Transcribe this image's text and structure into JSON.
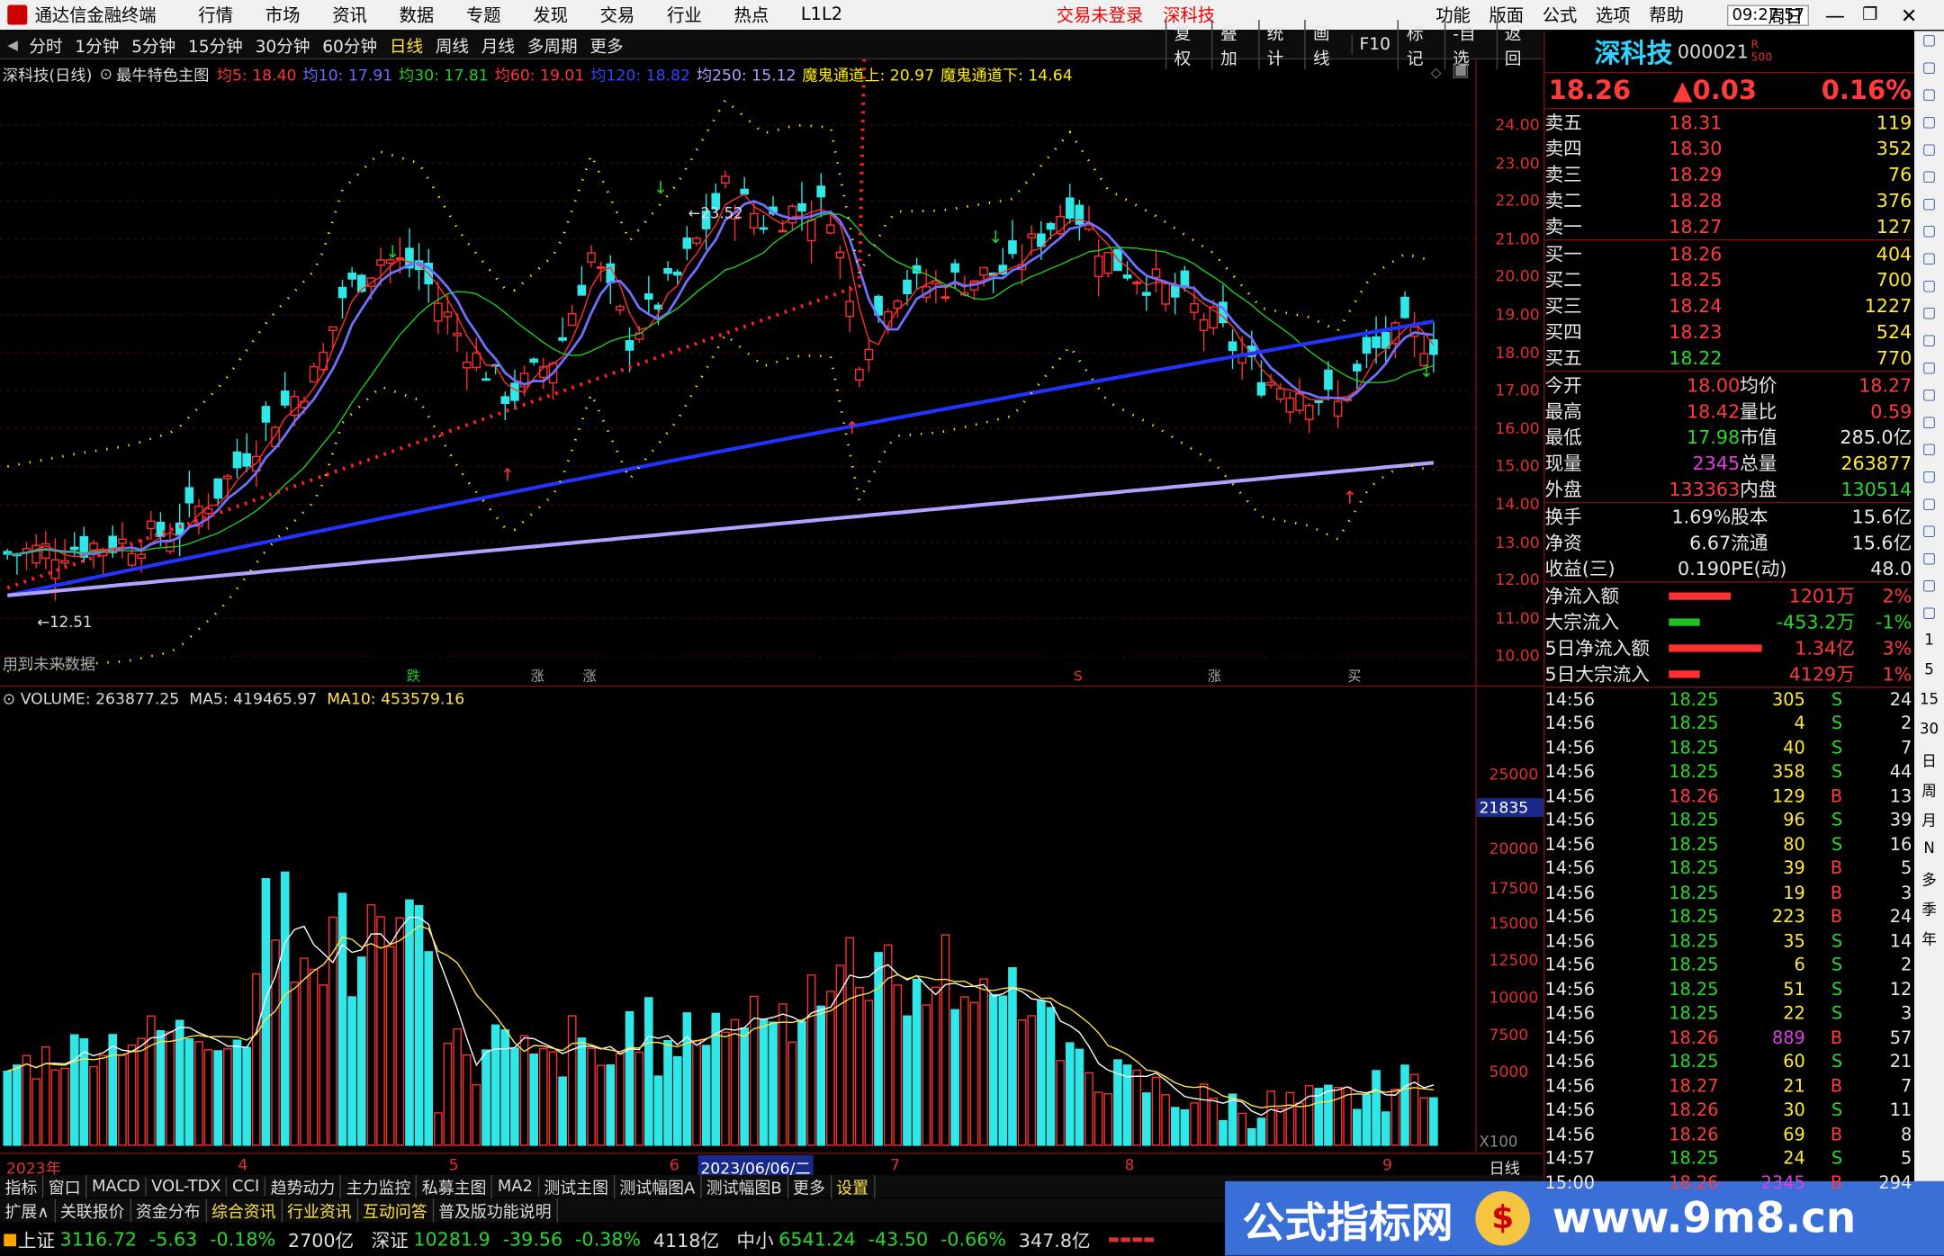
{
  "titlebar": {
    "app_name": "通达信金融终端",
    "menu": [
      "行情",
      "市场",
      "资讯",
      "数据",
      "专题",
      "发现",
      "交易",
      "行业",
      "热点",
      "L1L2"
    ],
    "status": "交易未登录",
    "stock": "深科技",
    "right_menu": [
      "功能",
      "版面",
      "公式",
      "选项",
      "帮助"
    ],
    "time": "09:27:57",
    "weekday": "周日"
  },
  "period_bar": {
    "periods": [
      "分时",
      "1分钟",
      "5分钟",
      "15分钟",
      "30分钟",
      "60分钟",
      "日线",
      "周线",
      "月线",
      "多周期",
      "更多"
    ],
    "active": "日线",
    "tools": [
      "复权",
      "叠加",
      "统计",
      "画线",
      "F10",
      "标记",
      "-自选",
      "返回"
    ]
  },
  "main_chart": {
    "stock_label": "深科技(日线)",
    "indicator_name": "最牛特色主图",
    "ma": [
      {
        "label": "均5: 18.40",
        "color": "#ff3333"
      },
      {
        "label": "均10: 17.91",
        "color": "#6a6aff"
      },
      {
        "label": "均30: 17.81",
        "color": "#22cc22"
      },
      {
        "label": "均60: 19.01",
        "color": "#ff3333"
      },
      {
        "label": "均120: 18.82",
        "color": "#3344ff"
      },
      {
        "label": "均250: 15.12",
        "color": "#b0a0ff"
      },
      {
        "label": "魔鬼通道上: 20.97",
        "color": "#ffee00"
      },
      {
        "label": "魔鬼通道下: 14.64",
        "color": "#ffee00"
      }
    ],
    "high_marker": "23.52",
    "low_marker": "12.51",
    "future_note": "用到未来数据",
    "price_axis": [
      "24.00",
      "23.00",
      "22.00",
      "21.00",
      "20.00",
      "19.00",
      "18.00",
      "17.00",
      "16.00",
      "15.00",
      "14.00",
      "13.00",
      "12.00",
      "11.00",
      "10.00"
    ],
    "signal_labels": [
      "跌",
      "涨",
      "涨",
      "S",
      "涨",
      "买"
    ]
  },
  "volume_chart": {
    "label": "VOLUME: 263877.25",
    "ma5": "MA5: 419465.97",
    "ma10": "MA10: 453579.16",
    "axis": [
      "25000",
      "20000",
      "17500",
      "15000",
      "12500",
      "10000",
      "7500",
      "5000"
    ],
    "cursor_value": "21835",
    "unit": "X100"
  },
  "date_axis": {
    "labels": [
      "2023年",
      "4",
      "5",
      "6",
      "7",
      "8",
      "9"
    ],
    "cursor_date": "2023/06/06/二",
    "period": "日线"
  },
  "bottom_tabs": [
    "指标",
    "窗口",
    "MACD",
    "VOL-TDX",
    "CCI",
    "趋势动力",
    "主力监控",
    "私募主图",
    "MA2",
    "测试主图",
    "测试幅图A",
    "测试幅图B",
    "更多",
    "设置"
  ],
  "bottom_tabs2": [
    "扩展∧",
    "关联报价",
    "资金分布",
    "综合资讯",
    "行业资讯",
    "互动问答",
    "普及版功能说明"
  ],
  "index_bar": [
    {
      "name": "上证",
      "value": "3116.72",
      "chg": "-5.63",
      "pct": "-0.18%",
      "amt": "2700亿"
    },
    {
      "name": "深证",
      "value": "10281.9",
      "chg": "-39.56",
      "pct": "-0.38%",
      "amt": "4118亿"
    },
    {
      "name": "中小",
      "value": "6541.24",
      "chg": "-43.50",
      "pct": "-0.66%",
      "amt": "347.8亿"
    }
  ],
  "watermark": {
    "text1": "公式指标网",
    "text2": "www.9m8.cn"
  },
  "quote": {
    "name": "深科技",
    "code": "000021",
    "badge1": "R",
    "badge2": "500",
    "price": "18.26",
    "change": "▲0.03",
    "pct": "0.16%",
    "asks": [
      {
        "label": "卖五",
        "price": "18.31",
        "vol": "119"
      },
      {
        "label": "卖四",
        "price": "18.30",
        "vol": "352"
      },
      {
        "label": "卖三",
        "price": "18.29",
        "vol": "76"
      },
      {
        "label": "卖二",
        "price": "18.28",
        "vol": "376"
      },
      {
        "label": "卖一",
        "price": "18.27",
        "vol": "127"
      }
    ],
    "bids": [
      {
        "label": "买一",
        "price": "18.26",
        "vol": "404"
      },
      {
        "label": "买二",
        "price": "18.25",
        "vol": "700"
      },
      {
        "label": "买三",
        "price": "18.24",
        "vol": "1227"
      },
      {
        "label": "买四",
        "price": "18.23",
        "vol": "524"
      },
      {
        "label": "买五",
        "price": "18.22",
        "vol": "770"
      }
    ],
    "stats": [
      {
        "k1": "今开",
        "v1": "18.00",
        "k2": "均价",
        "v2": "18.27"
      },
      {
        "k1": "最高",
        "v1": "18.42",
        "k2": "量比",
        "v2": "0.59"
      },
      {
        "k1": "最低",
        "v1": "17.98",
        "k2": "市值",
        "v2": "285.0亿"
      },
      {
        "k1": "现量",
        "v1": "2345",
        "k2": "总量",
        "v2": "263877"
      },
      {
        "k1": "外盘",
        "v1": "133363",
        "k2": "内盘",
        "v2": "130514"
      }
    ],
    "stats2": [
      {
        "k1": "换手",
        "v1": "1.69%",
        "k2": "股本",
        "v2": "15.6亿"
      },
      {
        "k1": "净资",
        "v1": "6.67",
        "k2": "流通",
        "v2": "15.6亿"
      },
      {
        "k1": "收益(三)",
        "v1": "0.190",
        "k2": "PE(动)",
        "v2": "48.0"
      }
    ],
    "flows": [
      {
        "label": "净流入额",
        "value": "1201万",
        "pct": "2%",
        "bar": 0.02
      },
      {
        "label": "大宗流入",
        "value": "-453.2万",
        "pct": "-1%",
        "bar": -0.01
      },
      {
        "label": "5日净流入额",
        "value": "1.34亿",
        "pct": "3%",
        "bar": 0.03
      },
      {
        "label": "5日大宗流入",
        "value": "4129万",
        "pct": "1%",
        "bar": 0.01
      }
    ],
    "ticks": [
      {
        "t": "14:56",
        "p": "18.25",
        "v": "305",
        "s": "S",
        "n": "24"
      },
      {
        "t": "14:56",
        "p": "18.25",
        "v": "4",
        "s": "S",
        "n": "2"
      },
      {
        "t": "14:56",
        "p": "18.25",
        "v": "40",
        "s": "S",
        "n": "7"
      },
      {
        "t": "14:56",
        "p": "18.25",
        "v": "358",
        "s": "S",
        "n": "44"
      },
      {
        "t": "14:56",
        "p": "18.26",
        "v": "129",
        "s": "B",
        "n": "13"
      },
      {
        "t": "14:56",
        "p": "18.25",
        "v": "96",
        "s": "S",
        "n": "39"
      },
      {
        "t": "14:56",
        "p": "18.25",
        "v": "80",
        "s": "S",
        "n": "16"
      },
      {
        "t": "14:56",
        "p": "18.25",
        "v": "39",
        "s": "B",
        "n": "5"
      },
      {
        "t": "14:56",
        "p": "18.25",
        "v": "19",
        "s": "B",
        "n": "3"
      },
      {
        "t": "14:56",
        "p": "18.25",
        "v": "223",
        "s": "B",
        "n": "24"
      },
      {
        "t": "14:56",
        "p": "18.25",
        "v": "35",
        "s": "S",
        "n": "14"
      },
      {
        "t": "14:56",
        "p": "18.25",
        "v": "6",
        "s": "S",
        "n": "2"
      },
      {
        "t": "14:56",
        "p": "18.25",
        "v": "51",
        "s": "S",
        "n": "12"
      },
      {
        "t": "14:56",
        "p": "18.25",
        "v": "22",
        "s": "S",
        "n": "3"
      },
      {
        "t": "14:56",
        "p": "18.26",
        "v": "889",
        "s": "B",
        "n": "57"
      },
      {
        "t": "14:56",
        "p": "18.25",
        "v": "60",
        "s": "S",
        "n": "21"
      },
      {
        "t": "14:56",
        "p": "18.27",
        "v": "21",
        "s": "B",
        "n": "7"
      },
      {
        "t": "14:56",
        "p": "18.26",
        "v": "30",
        "s": "S",
        "n": "11"
      },
      {
        "t": "14:56",
        "p": "18.26",
        "v": "69",
        "s": "B",
        "n": "8"
      },
      {
        "t": "14:57",
        "p": "18.25",
        "v": "24",
        "s": "S",
        "n": "5"
      },
      {
        "t": "15:00",
        "p": "18.26",
        "v": "2345",
        "s": "B",
        "n": "294"
      }
    ]
  },
  "side_toolbar": [
    "1",
    "5",
    "15",
    "30",
    "日",
    "周",
    "月",
    "N",
    "多",
    "季",
    "年"
  ],
  "colors": {
    "up": "#ff3b3b",
    "down": "#29d829",
    "frame": "#7a1010",
    "accent": "#ffe24d"
  }
}
